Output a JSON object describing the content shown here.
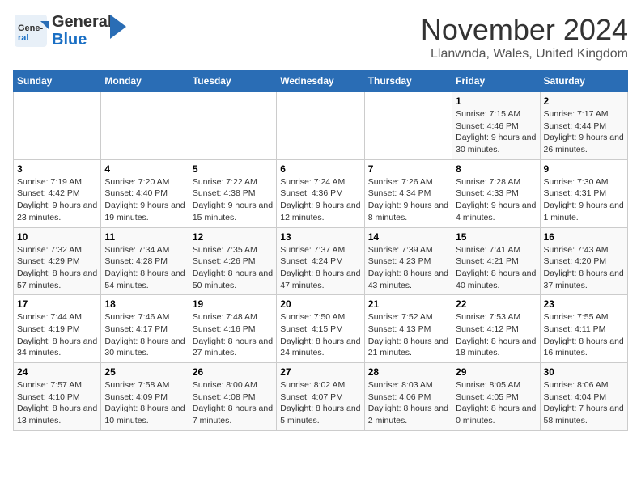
{
  "header": {
    "logo_line1": "General",
    "logo_line2": "Blue",
    "month": "November 2024",
    "location": "Llanwnda, Wales, United Kingdom"
  },
  "weekdays": [
    "Sunday",
    "Monday",
    "Tuesday",
    "Wednesday",
    "Thursday",
    "Friday",
    "Saturday"
  ],
  "weeks": [
    [
      {
        "day": "",
        "info": ""
      },
      {
        "day": "",
        "info": ""
      },
      {
        "day": "",
        "info": ""
      },
      {
        "day": "",
        "info": ""
      },
      {
        "day": "",
        "info": ""
      },
      {
        "day": "1",
        "info": "Sunrise: 7:15 AM\nSunset: 4:46 PM\nDaylight: 9 hours and 30 minutes."
      },
      {
        "day": "2",
        "info": "Sunrise: 7:17 AM\nSunset: 4:44 PM\nDaylight: 9 hours and 26 minutes."
      }
    ],
    [
      {
        "day": "3",
        "info": "Sunrise: 7:19 AM\nSunset: 4:42 PM\nDaylight: 9 hours and 23 minutes."
      },
      {
        "day": "4",
        "info": "Sunrise: 7:20 AM\nSunset: 4:40 PM\nDaylight: 9 hours and 19 minutes."
      },
      {
        "day": "5",
        "info": "Sunrise: 7:22 AM\nSunset: 4:38 PM\nDaylight: 9 hours and 15 minutes."
      },
      {
        "day": "6",
        "info": "Sunrise: 7:24 AM\nSunset: 4:36 PM\nDaylight: 9 hours and 12 minutes."
      },
      {
        "day": "7",
        "info": "Sunrise: 7:26 AM\nSunset: 4:34 PM\nDaylight: 9 hours and 8 minutes."
      },
      {
        "day": "8",
        "info": "Sunrise: 7:28 AM\nSunset: 4:33 PM\nDaylight: 9 hours and 4 minutes."
      },
      {
        "day": "9",
        "info": "Sunrise: 7:30 AM\nSunset: 4:31 PM\nDaylight: 9 hours and 1 minute."
      }
    ],
    [
      {
        "day": "10",
        "info": "Sunrise: 7:32 AM\nSunset: 4:29 PM\nDaylight: 8 hours and 57 minutes."
      },
      {
        "day": "11",
        "info": "Sunrise: 7:34 AM\nSunset: 4:28 PM\nDaylight: 8 hours and 54 minutes."
      },
      {
        "day": "12",
        "info": "Sunrise: 7:35 AM\nSunset: 4:26 PM\nDaylight: 8 hours and 50 minutes."
      },
      {
        "day": "13",
        "info": "Sunrise: 7:37 AM\nSunset: 4:24 PM\nDaylight: 8 hours and 47 minutes."
      },
      {
        "day": "14",
        "info": "Sunrise: 7:39 AM\nSunset: 4:23 PM\nDaylight: 8 hours and 43 minutes."
      },
      {
        "day": "15",
        "info": "Sunrise: 7:41 AM\nSunset: 4:21 PM\nDaylight: 8 hours and 40 minutes."
      },
      {
        "day": "16",
        "info": "Sunrise: 7:43 AM\nSunset: 4:20 PM\nDaylight: 8 hours and 37 minutes."
      }
    ],
    [
      {
        "day": "17",
        "info": "Sunrise: 7:44 AM\nSunset: 4:19 PM\nDaylight: 8 hours and 34 minutes."
      },
      {
        "day": "18",
        "info": "Sunrise: 7:46 AM\nSunset: 4:17 PM\nDaylight: 8 hours and 30 minutes."
      },
      {
        "day": "19",
        "info": "Sunrise: 7:48 AM\nSunset: 4:16 PM\nDaylight: 8 hours and 27 minutes."
      },
      {
        "day": "20",
        "info": "Sunrise: 7:50 AM\nSunset: 4:15 PM\nDaylight: 8 hours and 24 minutes."
      },
      {
        "day": "21",
        "info": "Sunrise: 7:52 AM\nSunset: 4:13 PM\nDaylight: 8 hours and 21 minutes."
      },
      {
        "day": "22",
        "info": "Sunrise: 7:53 AM\nSunset: 4:12 PM\nDaylight: 8 hours and 18 minutes."
      },
      {
        "day": "23",
        "info": "Sunrise: 7:55 AM\nSunset: 4:11 PM\nDaylight: 8 hours and 16 minutes."
      }
    ],
    [
      {
        "day": "24",
        "info": "Sunrise: 7:57 AM\nSunset: 4:10 PM\nDaylight: 8 hours and 13 minutes."
      },
      {
        "day": "25",
        "info": "Sunrise: 7:58 AM\nSunset: 4:09 PM\nDaylight: 8 hours and 10 minutes."
      },
      {
        "day": "26",
        "info": "Sunrise: 8:00 AM\nSunset: 4:08 PM\nDaylight: 8 hours and 7 minutes."
      },
      {
        "day": "27",
        "info": "Sunrise: 8:02 AM\nSunset: 4:07 PM\nDaylight: 8 hours and 5 minutes."
      },
      {
        "day": "28",
        "info": "Sunrise: 8:03 AM\nSunset: 4:06 PM\nDaylight: 8 hours and 2 minutes."
      },
      {
        "day": "29",
        "info": "Sunrise: 8:05 AM\nSunset: 4:05 PM\nDaylight: 8 hours and 0 minutes."
      },
      {
        "day": "30",
        "info": "Sunrise: 8:06 AM\nSunset: 4:04 PM\nDaylight: 7 hours and 58 minutes."
      }
    ]
  ]
}
